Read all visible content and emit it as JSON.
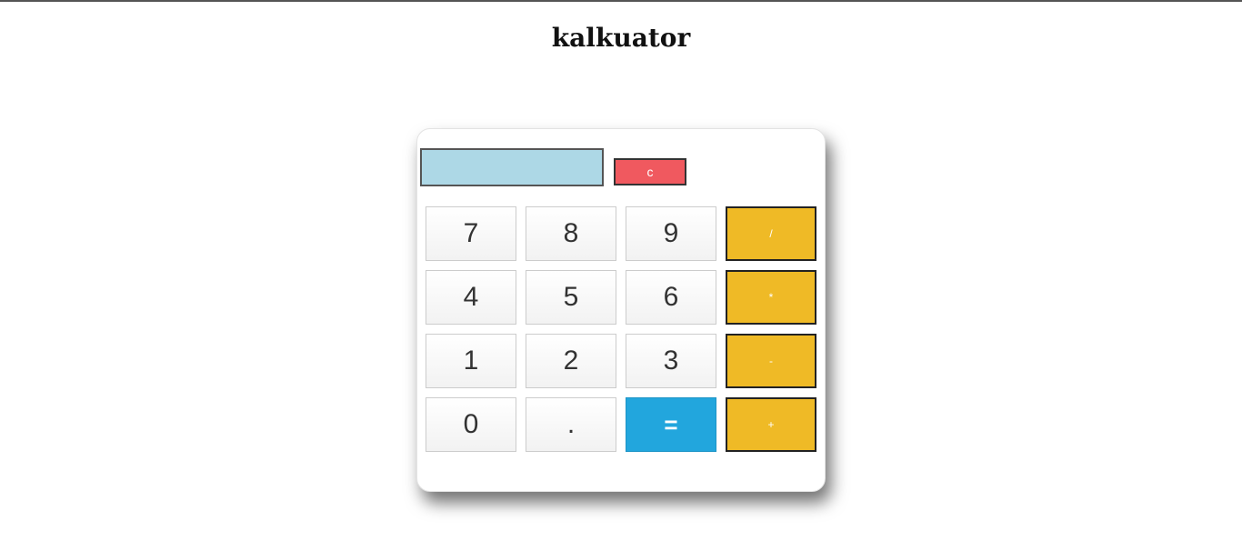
{
  "page": {
    "title": "kalkuator"
  },
  "calculator": {
    "display_value": "",
    "clear_label": "c",
    "colors": {
      "display": "#add8e6",
      "clear": "#f0595f",
      "operator": "#efba26",
      "equals": "#22a6dd"
    },
    "buttons": {
      "n7": "7",
      "n8": "8",
      "n9": "9",
      "div": "/",
      "n4": "4",
      "n5": "5",
      "n6": "6",
      "mul": "*",
      "n1": "1",
      "n2": "2",
      "n3": "3",
      "sub": "-",
      "n0": "0",
      "dot": ".",
      "eq": "=",
      "add": "+"
    }
  }
}
